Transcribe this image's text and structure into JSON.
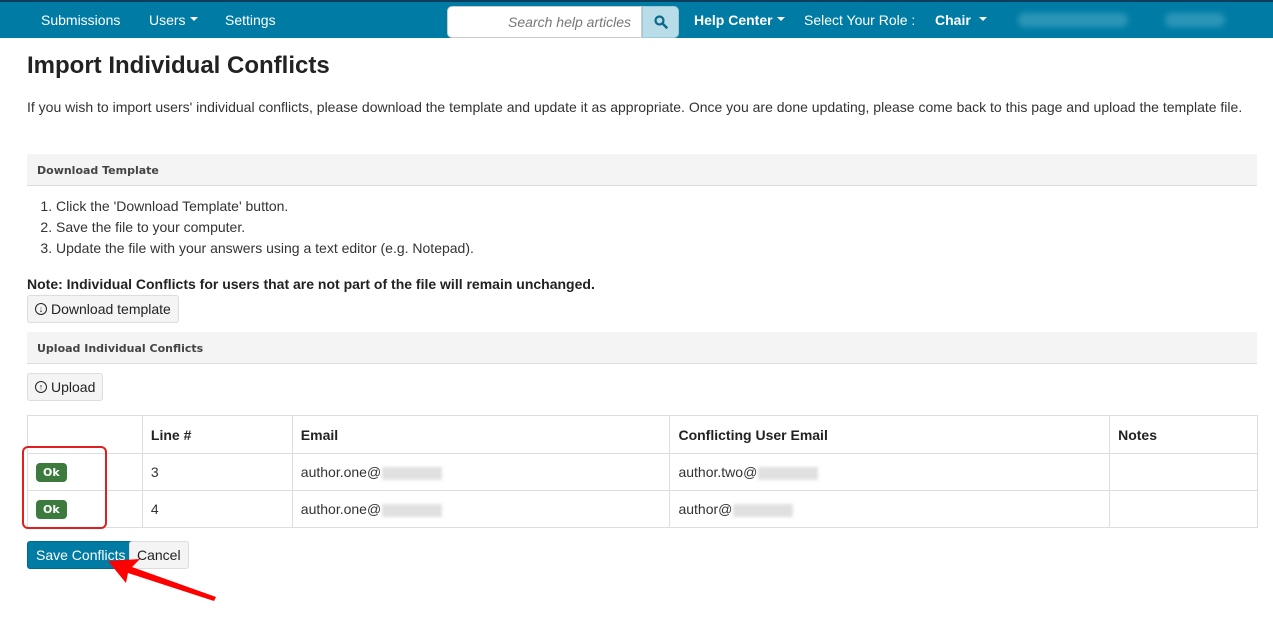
{
  "navbar": {
    "items": [
      {
        "label": "Submissions"
      },
      {
        "label": "Users",
        "has_dropdown": true
      },
      {
        "label": "Settings"
      }
    ],
    "search": {
      "placeholder": "Search help articles",
      "icon": "search-icon"
    },
    "help_center": "Help Center",
    "role_label": "Select Your Role :",
    "role_value": "Chair",
    "colors": {
      "background": "#007ca4",
      "search_button": "#b9dde8"
    }
  },
  "page": {
    "title": "Import Individual Conflicts",
    "intro": "If you wish to import users' individual conflicts, please download the template and update it as appropriate. Once you are done updating, please come back to this page and upload the template file."
  },
  "download_section": {
    "heading": "Download Template",
    "steps": [
      "Click the 'Download Template' button.",
      "Save the file to your computer.",
      "Update the file with your answers using a text editor (e.g. Notepad)."
    ],
    "note": "Note: Individual Conflicts for users that are not part of the file will remain unchanged.",
    "button_label": "Download template"
  },
  "upload_section": {
    "heading": "Upload Individual Conflicts",
    "button_label": "Upload"
  },
  "table": {
    "columns": [
      "",
      "Line #",
      "Email",
      "Conflicting User Email",
      "Notes"
    ],
    "rows": [
      {
        "status": "Ok",
        "line": "3",
        "email": "author.one@",
        "conflicting_email": "author.two@",
        "notes": ""
      },
      {
        "status": "Ok",
        "line": "4",
        "email": "author.one@",
        "conflicting_email": "author@",
        "notes": ""
      }
    ],
    "status_color": "#3c7a3d"
  },
  "actions": {
    "save_label": "Save Conflicts",
    "cancel_label": "Cancel"
  }
}
